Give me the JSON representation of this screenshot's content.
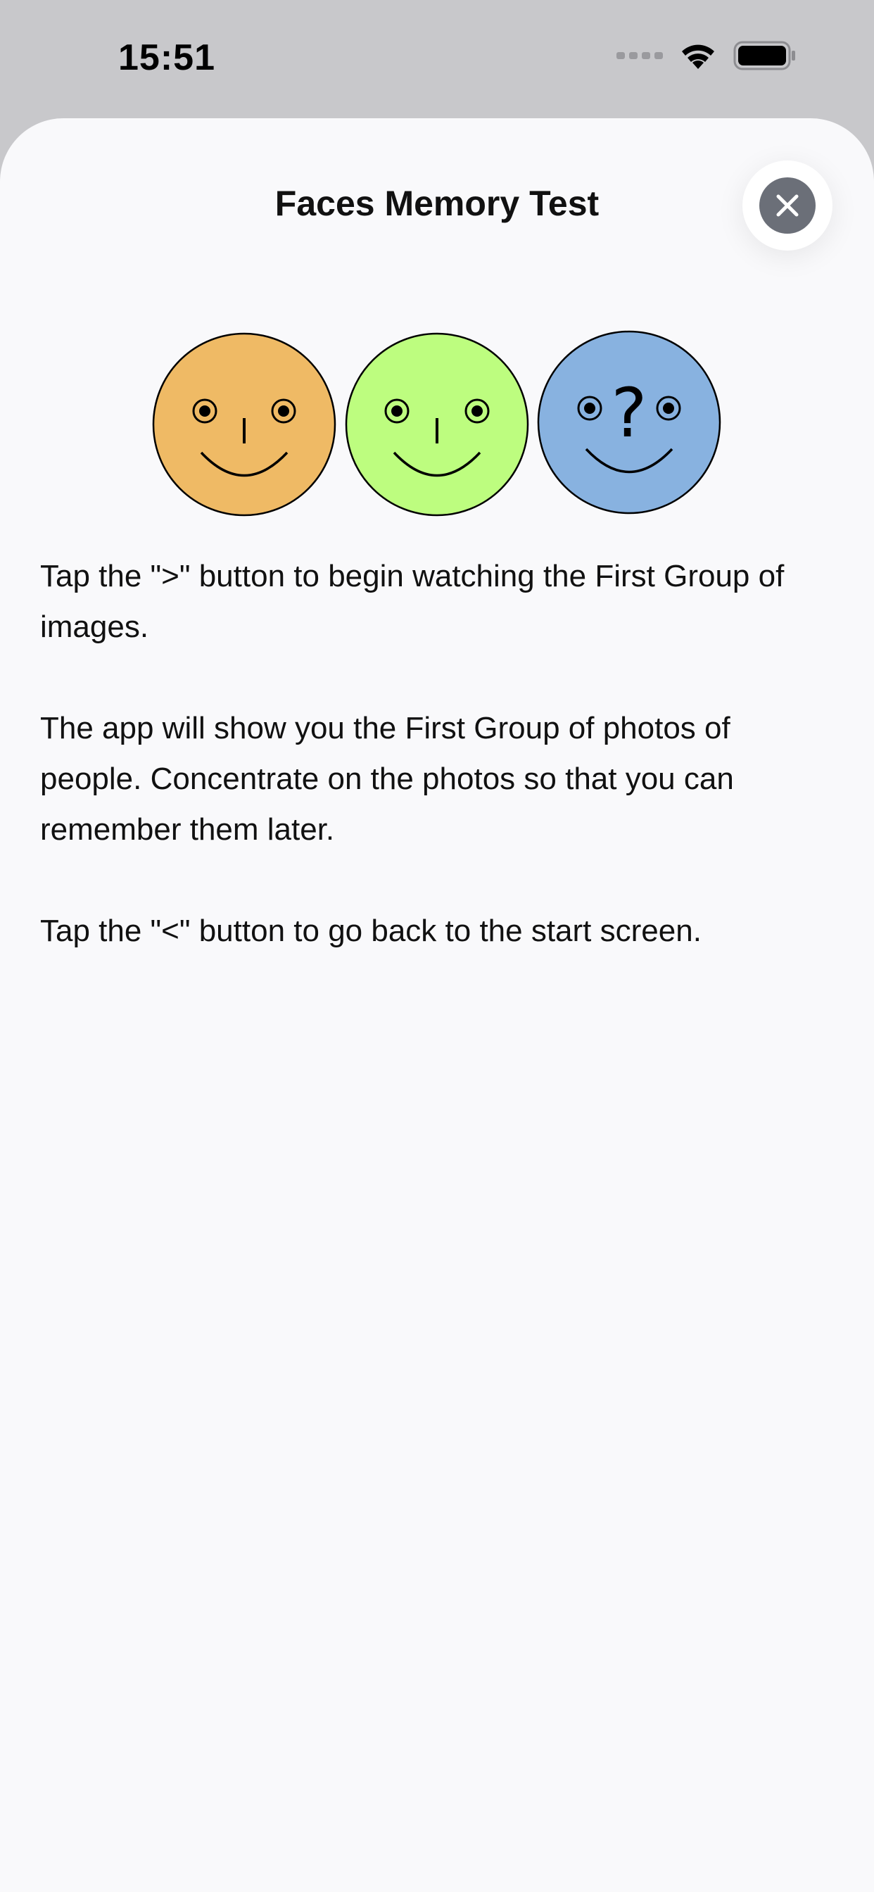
{
  "status_bar": {
    "time": "15:51",
    "icons": [
      "cellular-dots-icon",
      "wifi-icon",
      "battery-icon"
    ]
  },
  "sheet": {
    "title": "Faces Memory Test",
    "close_icon": "close-icon"
  },
  "faces": [
    {
      "color": "#efba65",
      "symbol": "nose"
    },
    {
      "color": "#bdfd7f",
      "symbol": "nose"
    },
    {
      "color": "#88b2e0",
      "symbol": "?"
    }
  ],
  "instructions": [
    "Tap the \">\" button to begin watching the First Group of images.",
    "The app will show you the First Group of photos of people. Concentrate on the photos so that you can remember them later.",
    "Tap the \"<\" button to go back to the start screen."
  ],
  "colors": {
    "status_bg": "#c8c8cb",
    "sheet_bg": "#f9f9fb",
    "close_button": "#6b6f78"
  }
}
